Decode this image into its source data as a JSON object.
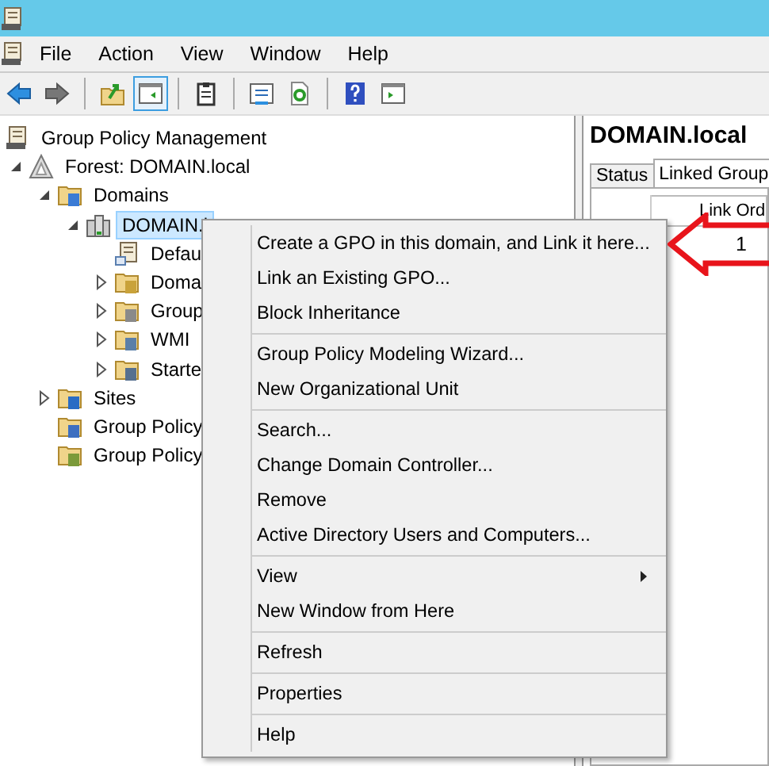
{
  "menu_bar": [
    "File",
    "Action",
    "View",
    "Window",
    "Help"
  ],
  "toolbar": [
    {
      "kind": "back",
      "pressed": false
    },
    {
      "kind": "forward",
      "pressed": false
    },
    {
      "kind": "sep"
    },
    {
      "kind": "up",
      "pressed": false
    },
    {
      "kind": "tree",
      "pressed": true
    },
    {
      "kind": "sep"
    },
    {
      "kind": "clipboard",
      "pressed": false
    },
    {
      "kind": "sep"
    },
    {
      "kind": "properties",
      "pressed": false
    },
    {
      "kind": "refresh",
      "pressed": false
    },
    {
      "kind": "sep"
    },
    {
      "kind": "help",
      "pressed": false
    },
    {
      "kind": "action",
      "pressed": false
    }
  ],
  "tree": [
    {
      "label": "Group Policy Management",
      "kind": "console",
      "selected": false,
      "children": [
        {
          "label": "Forest: DOMAIN.local",
          "kind": "forest",
          "expanded": true,
          "selected": false,
          "children": [
            {
              "label": "Domains",
              "kind": "domains",
              "expanded": true,
              "selected": false,
              "children": [
                {
                  "label": "DOMAIN.l",
                  "kind": "domain",
                  "expanded": true,
                  "selected": true,
                  "children": [
                    {
                      "label": "Defau",
                      "kind": "gpo",
                      "selected": false
                    },
                    {
                      "label": "Doma",
                      "kind": "ou",
                      "expanded": false,
                      "selected": false
                    },
                    {
                      "label": "Group",
                      "kind": "gpofolder",
                      "expanded": false,
                      "selected": false
                    },
                    {
                      "label": "WMI",
                      "kind": "wmi",
                      "expanded": false,
                      "selected": false
                    },
                    {
                      "label": "Starte",
                      "kind": "starter",
                      "expanded": false,
                      "selected": false
                    }
                  ]
                }
              ]
            },
            {
              "label": "Sites",
              "kind": "sites",
              "expanded": false,
              "selected": false
            },
            {
              "label": "Group Policy",
              "kind": "modeling",
              "selected": false
            },
            {
              "label": "Group Policy",
              "kind": "results",
              "selected": false
            }
          ]
        }
      ]
    }
  ],
  "details": {
    "title": "DOMAIN.local",
    "tabs": [
      {
        "label": "Status",
        "selected": false
      },
      {
        "label": "Linked Group",
        "selected": true
      }
    ],
    "column": "Link Ord",
    "rows": [
      "1"
    ]
  },
  "context_menu": [
    [
      {
        "label": "Create a GPO in this domain, and Link it here...",
        "submenu": false
      },
      {
        "label": "Link an Existing GPO...",
        "submenu": false
      },
      {
        "label": "Block Inheritance",
        "submenu": false
      }
    ],
    [
      {
        "label": "Group Policy Modeling Wizard...",
        "submenu": false
      },
      {
        "label": "New Organizational Unit",
        "submenu": false
      }
    ],
    [
      {
        "label": "Search...",
        "submenu": false
      },
      {
        "label": "Change Domain Controller...",
        "submenu": false
      },
      {
        "label": "Remove",
        "submenu": false
      },
      {
        "label": "Active Directory Users and Computers...",
        "submenu": false
      }
    ],
    [
      {
        "label": "View",
        "submenu": true
      },
      {
        "label": "New Window from Here",
        "submenu": false
      }
    ],
    [
      {
        "label": "Refresh",
        "submenu": false
      }
    ],
    [
      {
        "label": "Properties",
        "submenu": false
      }
    ],
    [
      {
        "label": "Help",
        "submenu": false
      }
    ]
  ]
}
